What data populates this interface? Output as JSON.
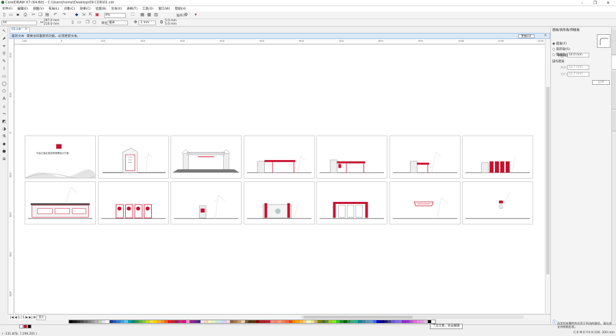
{
  "window": {
    "title": "CorelDRAW X7 (64-Bit) - C:\\Users\\home\\Desktop\\09.CDR\\01.cdr"
  },
  "menu": [
    "文件(F)",
    "编辑(E)",
    "视图(V)",
    "布局(L)",
    "对象(C)",
    "效果(C)",
    "位图(B)",
    "文本(X)",
    "表格(T)",
    "工具(O)",
    "窗口(W)",
    "帮助(H)"
  ],
  "toolbar": {
    "zoom_value": "8%",
    "snap_label": "贴齐(T)"
  },
  "propbar": {
    "page_size": "A4",
    "width": "297.0 mm",
    "height": "210.0 mm",
    "units_label": "单位:",
    "units_value": "毫米",
    "nudge": ".1 mm",
    "dup_x": "5.0 mm",
    "dup_y": "5.0 mm"
  },
  "doc_tab": {
    "label": "01.cdr"
  },
  "infobar": {
    "title": "最新文本",
    "message": "需要访问最新的功能，必须更新文本。",
    "button": "更新(U)"
  },
  "rulers": {
    "h_ticks": [
      "-100",
      "0",
      "100",
      "200",
      "300",
      "400",
      "500",
      "600",
      "700",
      "800",
      "900",
      "1000",
      "1100",
      "1200"
    ],
    "v_ticks": [
      "200",
      "100",
      "0",
      "-100",
      "-200",
      "-300",
      "-400"
    ]
  },
  "page_nav": {
    "counter": "1 / 1",
    "page_tab": "页1"
  },
  "status": {
    "coords": "( -131.878, 7,299.201 )",
    "tooltip": "个位元素，双击编辑",
    "color_info": "C:0 M:0 Y:0 K:100 .200 mm"
  },
  "docker": {
    "header": "圆角/扇形角/倒棱角",
    "options": [
      "圆角(F)",
      "扇形角(S)",
      "倒棱角(C)"
    ],
    "radius_label": "半径(R):",
    "radius_value": "10.0 mm",
    "distance_label": "操作距离",
    "field_x_label": "X(X):",
    "field_x_value": "12.7 mm",
    "field_y_label": "Y(Y):",
    "field_y_value": "12.7 mm",
    "apply_button": "应用",
    "hint": "选定的有属性的应用于所选的路径，请勾选支持倒角形状。"
  },
  "colors": {
    "accent_red": "#c8102e",
    "infobar_bg": "#dbe8f6",
    "palette": [
      "#000000",
      "#1a1a1a",
      "#333333",
      "#4d4d4d",
      "#666666",
      "#808080",
      "#999999",
      "#b3b3b3",
      "#cccccc",
      "#e6e6e6",
      "#ffffff",
      "#1b3a8a",
      "#1d5fbf",
      "#2a7fd6",
      "#3fa0e0",
      "#5cc3ee",
      "#00a0b0",
      "#00897b",
      "#2e9e44",
      "#5bb840",
      "#8cc63f",
      "#c2d72e",
      "#f2e530",
      "#ffd700",
      "#fbb034",
      "#f7941d",
      "#f26522",
      "#ed1c24",
      "#c1272d",
      "#9e1f63",
      "#d1267a",
      "#ec008c",
      "#f49ac1",
      "#a3238e",
      "#662d91",
      "#3b2c85",
      "#ffe5e5",
      "#ffd3b6",
      "#fff6c2",
      "#e7f5c6",
      "#c9ecd8",
      "#c8e4f7",
      "#d7d1ee",
      "#f2d7ea",
      "#8c6239",
      "#a67c52",
      "#c69c6d",
      "#e6ceac",
      "#7a5c3e",
      "#4d3319",
      "#603913",
      "#8b0000",
      "#a52a2a",
      "#b22222",
      "#dc143c",
      "#e9967a",
      "#fa8072",
      "#ffa07a",
      "#ff7f50",
      "#ff6347",
      "#ff4500",
      "#ff8c00",
      "#ffa500",
      "#ffb347",
      "#ffd27f",
      "#fffacd",
      "#f0e68c",
      "#bdb76b",
      "#808000",
      "#556b2f",
      "#6b8e23",
      "#9acd32",
      "#7cfc00",
      "#32cd32",
      "#228b22",
      "#006400",
      "#2e8b57",
      "#3cb371",
      "#20b2aa",
      "#008b8b",
      "#4682b4",
      "#5f9ea0",
      "#6495ed",
      "#4169e1",
      "#0000cd",
      "#00008b",
      "#191970",
      "#483d8b",
      "#6a5acd",
      "#7b68ee",
      "#9370db",
      "#8a2be2",
      "#9932cc",
      "#ba55d3",
      "#da70d6",
      "#ee82ee",
      "#dda0dd",
      "#d8bfd8",
      "#000000",
      "#ffffff"
    ],
    "ruler_bg": "#fbfbfb"
  },
  "thumbnails": {
    "first_caption": "乌龙江景区旅游导视牌设计方案"
  }
}
